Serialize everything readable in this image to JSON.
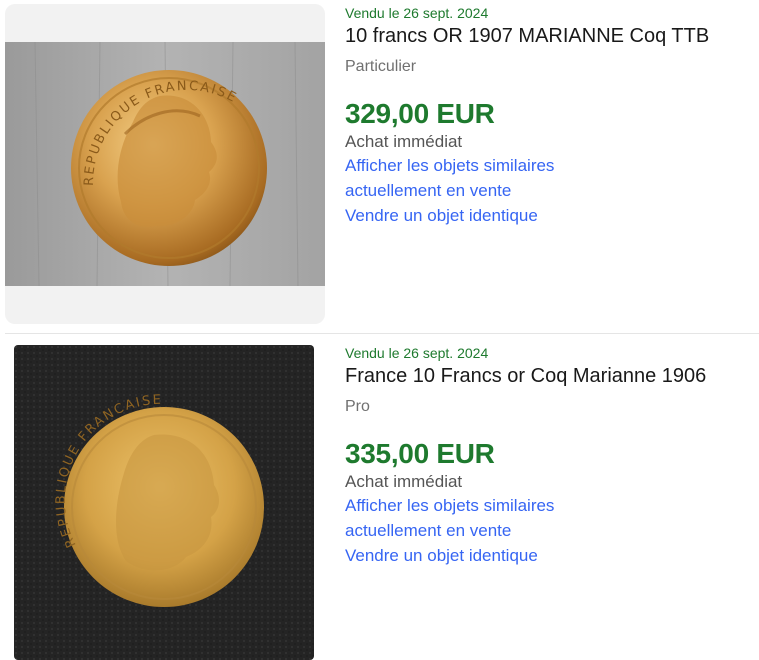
{
  "colors": {
    "sold_green": "#1e7a2e",
    "link_blue": "#3665f3",
    "secondary_text": "#707070",
    "title_text": "#191919"
  },
  "listings": [
    {
      "sold_date": "Vendu le 26 sept. 2024",
      "title": "10 francs OR 1907 MARIANNE Coq TTB",
      "seller_type": "Particulier",
      "price": "329,00 EUR",
      "buy_format": "Achat immédiat",
      "similar_link": "Afficher les objets similaires actuellement en vente",
      "sell_link": "Vendre un objet identique",
      "image": {
        "subject": "gold-coin-marianne-photo",
        "background": "grey-wood",
        "legend": "REPUBLIQUE FRANCAISE"
      }
    },
    {
      "sold_date": "Vendu le 26 sept. 2024",
      "title": "France 10 Francs or Coq Marianne 1906",
      "seller_type": "Pro",
      "price": "335,00 EUR",
      "buy_format": "Achat immédiat",
      "similar_link": "Afficher les objets similaires actuellement en vente",
      "sell_link": "Vendre un objet identique",
      "image": {
        "subject": "gold-coin-marianne-photo",
        "background": "black-fabric",
        "legend": "REPUBLIQUE FRANCAISE"
      }
    }
  ]
}
